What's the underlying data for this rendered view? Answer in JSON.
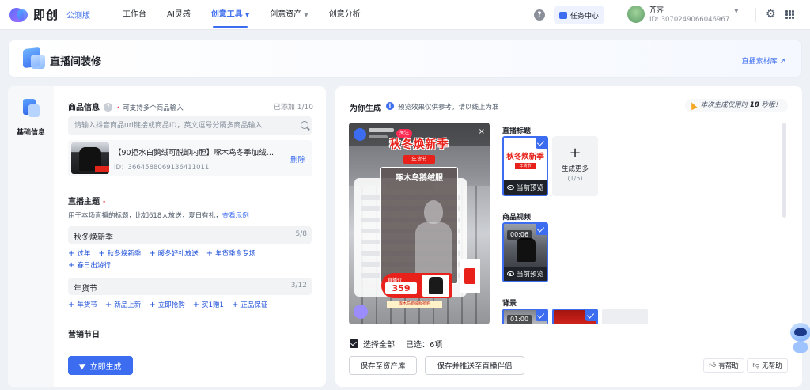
{
  "header": {
    "logo_text": "即创",
    "beta_label": "公测版",
    "nav": [
      {
        "label": "工作台",
        "caret": ""
      },
      {
        "label": "AI灵感",
        "caret": ""
      },
      {
        "label": "创意工具",
        "caret": "▼"
      },
      {
        "label": "创意资产",
        "caret": "▼"
      },
      {
        "label": "创意分析",
        "caret": ""
      }
    ],
    "active_nav": "创意工具",
    "help_icon": "?",
    "task_center": "任务中心",
    "user": {
      "name": "齐霁",
      "id": "ID: 3070249066046967"
    },
    "user_caret": "▼",
    "gear_icon": "⚙"
  },
  "page": {
    "title": "直播间装修",
    "library_link": "直播素材库 ↗"
  },
  "sidebar": {
    "tab_label": "基础信息"
  },
  "form": {
    "product_section": {
      "title": "商品信息",
      "hint": "可支持多个商品输入",
      "counter": "已添加 1/10",
      "search_placeholder": "请输入抖音商品url链接或商品ID，英文逗号分隔多商品输入",
      "product": {
        "name": "【90拒水白鹅绒可脱卸内胆】啄木鸟冬季加绒…",
        "id": "ID：3664588069136411011",
        "delete_label": "删除"
      }
    },
    "theme_section": {
      "title": "直播主题",
      "hint": "用于本场直播的标题，比如618大放送，夏日有礼，",
      "example_link": "查看示例",
      "value": "秋冬焕新季",
      "count": "5/8",
      "suggestions": [
        "过年",
        "秋冬焕新季",
        "暖冬好礼放送",
        "年货季食专场",
        "春日出游行"
      ]
    },
    "holiday_input": {
      "value": "年货节",
      "count": "3/12",
      "suggestions": [
        "年货节",
        "新品上新",
        "立即抢购",
        "买1赠1",
        "正品保证"
      ]
    },
    "marketing_section": {
      "title": "营销节日"
    },
    "generate_button": "立即生成"
  },
  "result": {
    "title": "为你生成",
    "info_icon": "i",
    "hint": "预览效果仅供参考，请以线上为准",
    "time_tip": {
      "prefix": "本次生成仅用时",
      "seconds": "18",
      "suffix": "秒哦！"
    },
    "preview": {
      "follow": "关注",
      "banner_title": "秋冬焕新季",
      "banner_sub": "年货节",
      "sku_name": "啄木鸟鹅绒服",
      "price_label": "直播价",
      "price": "359",
      "buy_label": "库木鸟鹅绒服抢购",
      "close": "×"
    },
    "options": {
      "title_label": "直播标题",
      "title_thumb_text": "秋冬焕新季",
      "title_thumb_sub": "年货节",
      "current_preview": "当前预览",
      "generate_more": "生成更多",
      "generate_count": "(1/5)",
      "video_label": "商品视频",
      "video_duration": "00:06",
      "bg_label": "背景",
      "bg_duration": "01:00"
    },
    "footer": {
      "select_all": "选择全部",
      "selected": "已选：6项",
      "save_assets": "保存至资产库",
      "save_push": "保存并推送至直播伴侣",
      "helpful": "有帮助",
      "not_helpful": "无帮助"
    }
  }
}
